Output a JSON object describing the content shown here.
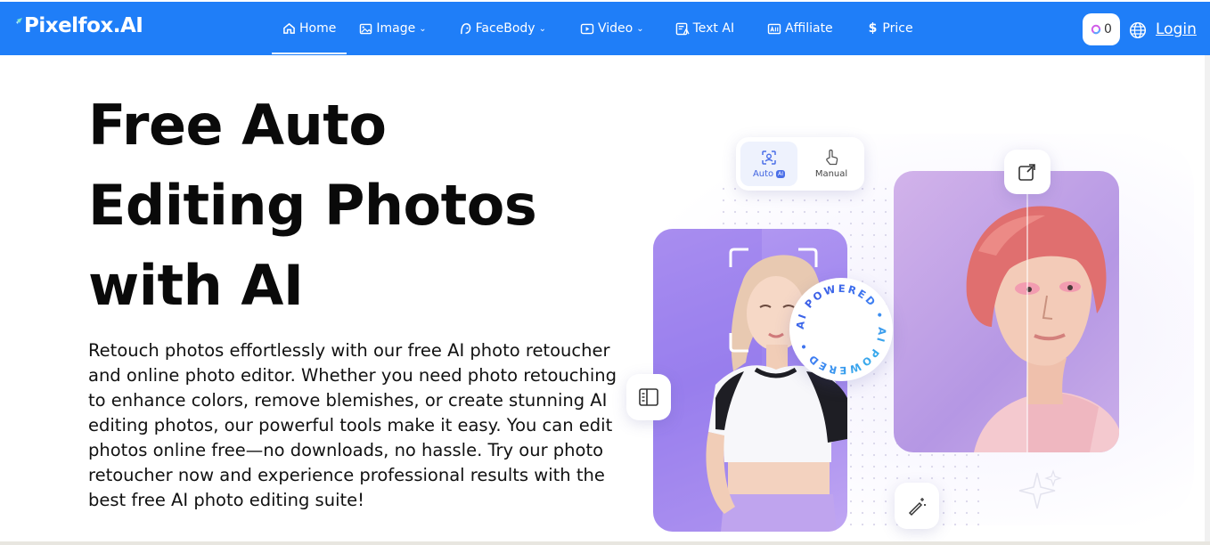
{
  "brand": {
    "name": "Pixelfox.AI"
  },
  "nav": {
    "items": [
      {
        "label": "Home",
        "icon": "home-icon",
        "active": true,
        "dropdown": false
      },
      {
        "label": "Image",
        "icon": "image-icon",
        "active": false,
        "dropdown": true
      },
      {
        "label": "FaceBody",
        "icon": "face-icon",
        "active": false,
        "dropdown": true
      },
      {
        "label": "Video",
        "icon": "video-icon",
        "active": false,
        "dropdown": true
      },
      {
        "label": "Text AI",
        "icon": "text-ai-icon",
        "active": false,
        "dropdown": false
      },
      {
        "label": "Affiliate",
        "icon": "affiliate-icon",
        "active": false,
        "dropdown": false
      },
      {
        "label": "Price",
        "icon": "dollar-icon",
        "active": false,
        "dropdown": false
      }
    ],
    "credits": "0",
    "login": "Login"
  },
  "hero": {
    "title_lines": [
      "Free Auto",
      "Editing Photos",
      "with AI"
    ],
    "description": "Retouch photos effortlessly with our free AI photo retoucher and online photo editor. Whether you need photo retouching to enhance colors, remove blemishes, or create stunning AI editing photos, our powerful tools make it easy. You can edit photos online free—no downloads, no hassle. Try our photo retoucher now and experience professional results with the best free AI photo editing suite!"
  },
  "illustration": {
    "mode_auto": "Auto",
    "mode_auto_badge": "AI",
    "mode_manual": "Manual",
    "badge_text": "AI POWERED • AI POWERED • "
  },
  "colors": {
    "nav_bg": "#1f7ef8",
    "accent_purple": "#8f7cf2",
    "text": "#0a0a0a"
  }
}
